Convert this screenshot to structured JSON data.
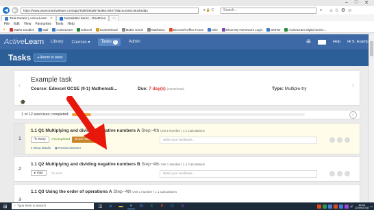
{
  "window": {
    "minimize": "–",
    "maximize": "□",
    "close": "✕"
  },
  "address_bar": {
    "url": "https://www.pearsonactivelearn.com/app/Task/Details?taskId=684778&courseId=Booked&s",
    "search_placeholder": "Search...",
    "icons": "▾ 🔒 C"
  },
  "tabs": [
    {
      "label": "Task Details | ActiveLearn",
      "active": true
    },
    {
      "label": "Newsletter Items - OneDrive",
      "active": false
    }
  ],
  "menu": [
    "File",
    "Edit",
    "View",
    "Favourites",
    "Tools",
    "Help"
  ],
  "favourites": [
    "Maths Doodlve",
    "Mail",
    "ActiveLearn",
    "Edexcel",
    "ExamWizard",
    "Maths Genie",
    "Mathsbox",
    "Microsoft Office Home",
    "Mint",
    "Show My Homework Login",
    "SMHW",
    "ActiveLearn Digital Servic..."
  ],
  "app_nav": {
    "logo_a": "Active",
    "logo_b": "Learn",
    "items": [
      "Library",
      "Courses ▾",
      "Tasks",
      "Admin"
    ],
    "tasks_count": "0",
    "right": [
      "Help",
      "Hi S. Example"
    ]
  },
  "page": {
    "title": "Tasks",
    "return_label": "◂ Return to tasks"
  },
  "task": {
    "name": "Example task",
    "course_label": "Course: Edexcel GCSE (9-1) Mathemati...",
    "due_label": "Due:",
    "due_value": "7 day(s)",
    "due_date": "(29/09/2018)",
    "type_label": "Type:",
    "type_value": "Multiple-try"
  },
  "progress": {
    "text": "1 of 12 exercises completed:",
    "fraction": 0.083
  },
  "exercises": [
    {
      "num": "1",
      "title": "1.1 Q1 Multiplying and dividing negative numbers A",
      "step": "Step−4th",
      "meta": "Unit 1 Number  |  1.1 Calculations",
      "retry": "↻ Retry",
      "completed": "✔Completed",
      "score": "Score 100%",
      "feedback": "Write your feedback...",
      "show_details": "▾ Show details",
      "review": "◉ Review answers"
    },
    {
      "num": "2",
      "title": "1.1 Q2 Multiplying and dividing negative numbers B",
      "step": "Step−4th",
      "meta": "Unit 1 Number  |  1.1 Calculations",
      "start": "▸ Start",
      "to_start": "To Start",
      "feedback": "Write your feedback..."
    },
    {
      "num": "3",
      "title": "1.1 Q3 Using the order of operations A",
      "step": "Step−4th",
      "meta": "Unit 1 Number  |  1.1 Calculations"
    }
  ],
  "taskbar": {
    "search": "Type here to search",
    "time": "16:01",
    "date": "22/09/2018"
  },
  "colors": {
    "nav": "#3d6aa6",
    "tasks_bar": "#2c5f98",
    "score": "#c8862c",
    "arrow": "#e8170c"
  }
}
